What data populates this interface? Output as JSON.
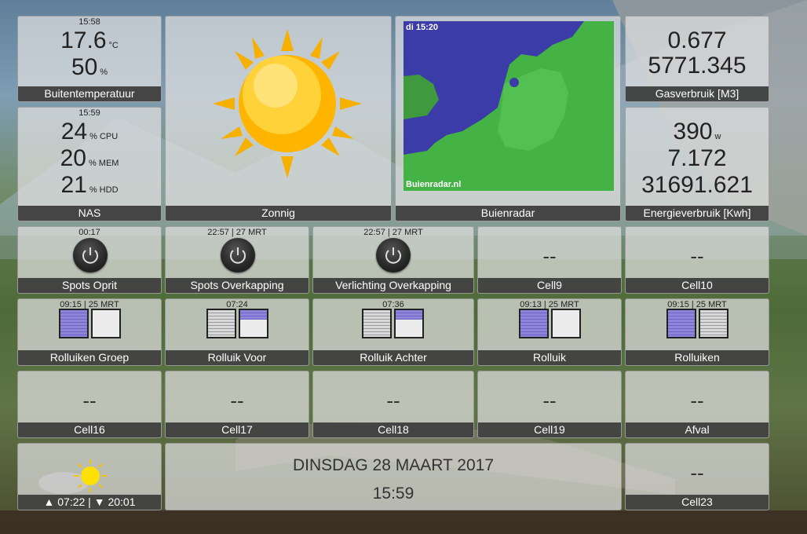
{
  "tiles": {
    "outdoor": {
      "time": "15:58",
      "temp": "17.6",
      "temp_unit": "°C",
      "humidity": "50",
      "humidity_unit": "%",
      "label": "Buitentemperatuur"
    },
    "nas": {
      "time": "15:59",
      "cpu": "24",
      "cpu_unit": "% CPU",
      "mem": "20",
      "mem_unit": "% MEM",
      "hdd": "21",
      "hdd_unit": "% HDD",
      "label": "NAS"
    },
    "zonnig": {
      "label": "Zonnig",
      "icon": "sun-icon"
    },
    "radar": {
      "timestamp": "di 15:20",
      "brand": "Buienradar.nl",
      "label": "Buienradar"
    },
    "gas": {
      "value1": "0.677",
      "value2": "5771.345",
      "label": "Gasverbruik [M3]"
    },
    "energy": {
      "power": "390",
      "power_unit": "w",
      "value2": "7.172",
      "value3": "31691.621",
      "label": "Energieverbruik [Kwh]"
    },
    "spots_oprit": {
      "time": "00:17",
      "label": "Spots Oprit"
    },
    "spots_overkapping": {
      "time": "22:57 | 27 MRT",
      "label": "Spots Overkapping"
    },
    "verlichting_overkapping": {
      "time": "22:57 | 27 MRT",
      "label": "Verlichting Overkapping"
    },
    "cell9": {
      "value": "--",
      "label": "Cell9"
    },
    "cell10": {
      "value": "--",
      "label": "Cell10"
    },
    "rolluiken_groep": {
      "time": "09:15 | 25 MRT",
      "label": "Rolluiken Groep"
    },
    "rolluik_voor": {
      "time": "07:24",
      "label": "Rolluik Voor"
    },
    "rolluik_achter": {
      "time": "07:36",
      "label": "Rolluik Achter"
    },
    "rolluik": {
      "time": "09:13 | 25 MRT",
      "label": "Rolluik"
    },
    "rolluiken": {
      "time": "09:15 | 25 MRT",
      "label": "Rolluiken"
    },
    "cell16": {
      "value": "--",
      "label": "Cell16"
    },
    "cell17": {
      "value": "--",
      "label": "Cell17"
    },
    "cell18": {
      "value": "--",
      "label": "Cell18"
    },
    "cell19": {
      "value": "--",
      "label": "Cell19"
    },
    "afval": {
      "value": "--",
      "label": "Afval"
    },
    "sun_times": {
      "label": "▲ 07:22 | ▼ 20:01"
    },
    "clock": {
      "date": "DINSDAG 28 MAART 2017",
      "time": "15:59"
    },
    "cell23": {
      "value": "--",
      "label": "Cell23"
    }
  },
  "colors": {
    "label_bg": "#3a3a3a",
    "shutter_purple": "#8f84d9",
    "radar_sea": "#3c3ca8",
    "radar_land": "#44b244"
  }
}
